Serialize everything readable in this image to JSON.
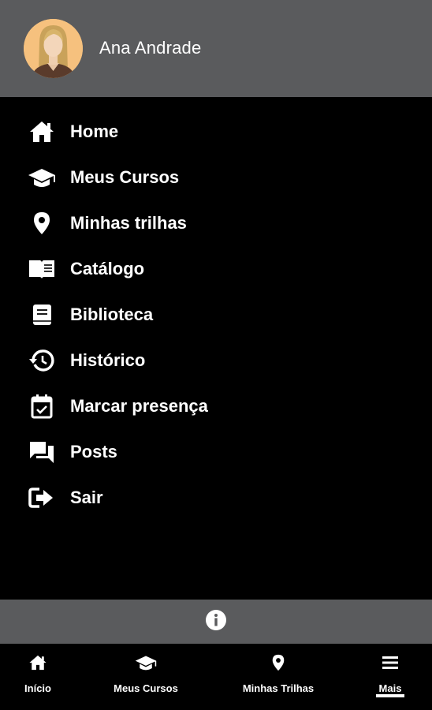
{
  "user": {
    "name": "Ana Andrade"
  },
  "menu": {
    "items": [
      {
        "label": "Home",
        "icon": "home-icon"
      },
      {
        "label": "Meus Cursos",
        "icon": "graduation-cap-icon"
      },
      {
        "label": "Minhas trilhas",
        "icon": "map-pin-icon"
      },
      {
        "label": "Catálogo",
        "icon": "open-book-icon"
      },
      {
        "label": "Biblioteca",
        "icon": "book-icon"
      },
      {
        "label": "Histórico",
        "icon": "history-icon"
      },
      {
        "label": "Marcar presença",
        "icon": "calendar-check-icon"
      },
      {
        "label": "Posts",
        "icon": "chat-bubbles-icon"
      },
      {
        "label": "Sair",
        "icon": "sign-out-icon"
      }
    ]
  },
  "info": {
    "icon": "info-icon"
  },
  "tabbar": {
    "tabs": [
      {
        "label": "Início",
        "icon": "home-icon"
      },
      {
        "label": "Meus Cursos",
        "icon": "graduation-cap-icon"
      },
      {
        "label": "Minhas Trilhas",
        "icon": "map-pin-icon"
      },
      {
        "label": "Mais",
        "icon": "hamburger-menu-icon",
        "active": true
      }
    ]
  },
  "colors": {
    "header_bg": "#5a5b5d",
    "background": "#000000",
    "text": "#ffffff",
    "avatar_bg": "#f6c17e"
  }
}
